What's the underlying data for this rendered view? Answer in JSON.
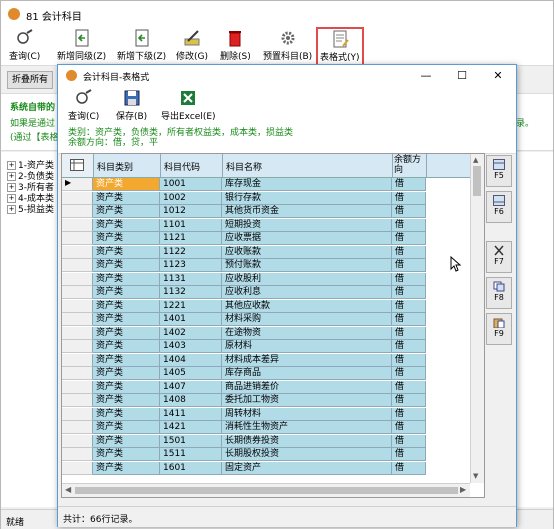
{
  "main_window": {
    "title": "81 会计科目",
    "toolbar": [
      {
        "label": "查询(C)",
        "icon": "query-icon"
      },
      {
        "label": "新增同级(Z)",
        "icon": "add-sibling-icon"
      },
      {
        "label": "新增下级(Z)",
        "icon": "add-child-icon"
      },
      {
        "label": "修改(G)",
        "icon": "edit-icon"
      },
      {
        "label": "删除(S)",
        "icon": "delete-icon"
      },
      {
        "label": "预置科目(B)",
        "icon": "gear-icon"
      },
      {
        "label": "表格式(Y)",
        "icon": "table-style-icon"
      }
    ],
    "collapse_label": "折叠所有",
    "desc_line1": "系统自带的",
    "desc_line2": "如果是通过",
    "desc_line2_right": "录。",
    "desc_line3": "(通过【表格",
    "tree": [
      "1-资产类",
      "2-负债类",
      "3-所有者",
      "4-成本类",
      "5-损益类"
    ],
    "status": "就绪",
    "accent_red": "#e14b4b"
  },
  "dialog": {
    "title": "会计科目-表格式",
    "toolbar": [
      {
        "label": "查询(C)",
        "icon": "query-icon"
      },
      {
        "label": "保存(B)",
        "icon": "save-icon"
      },
      {
        "label": "导出Excel(E)",
        "icon": "excel-icon"
      }
    ],
    "info_line1": "类别：资产类，负债类，所有者权益类，成本类，损益类",
    "info_line2": "余额方向：借，贷，平",
    "columns": [
      "科目类别",
      "科目代码",
      "科目名称",
      "余额方向"
    ],
    "rows": [
      [
        "资产类",
        "1001",
        "库存现金",
        "借"
      ],
      [
        "资产类",
        "1002",
        "银行存款",
        "借"
      ],
      [
        "资产类",
        "1012",
        "其他货币资金",
        "借"
      ],
      [
        "资产类",
        "1101",
        "短期投资",
        "借"
      ],
      [
        "资产类",
        "1121",
        "应收票据",
        "借"
      ],
      [
        "资产类",
        "1122",
        "应收账款",
        "借"
      ],
      [
        "资产类",
        "1123",
        "预付账款",
        "借"
      ],
      [
        "资产类",
        "1131",
        "应收股利",
        "借"
      ],
      [
        "资产类",
        "1132",
        "应收利息",
        "借"
      ],
      [
        "资产类",
        "1221",
        "其他应收款",
        "借"
      ],
      [
        "资产类",
        "1401",
        "材料采购",
        "借"
      ],
      [
        "资产类",
        "1402",
        "在途物资",
        "借"
      ],
      [
        "资产类",
        "1403",
        "原材料",
        "借"
      ],
      [
        "资产类",
        "1404",
        "材料成本差异",
        "借"
      ],
      [
        "资产类",
        "1405",
        "库存商品",
        "借"
      ],
      [
        "资产类",
        "1407",
        "商品进销差价",
        "借"
      ],
      [
        "资产类",
        "1408",
        "委托加工物资",
        "借"
      ],
      [
        "资产类",
        "1411",
        "周转材料",
        "借"
      ],
      [
        "资产类",
        "1421",
        "消耗性生物资产",
        "借"
      ],
      [
        "资产类",
        "1501",
        "长期债券投资",
        "借"
      ],
      [
        "资产类",
        "1511",
        "长期股权投资",
        "借"
      ],
      [
        "资产类",
        "1601",
        "固定资产",
        "借"
      ]
    ],
    "side_buttons": [
      "F5",
      "F6",
      "F7",
      "F8",
      "F9"
    ],
    "status": "共计：66行记录。"
  }
}
